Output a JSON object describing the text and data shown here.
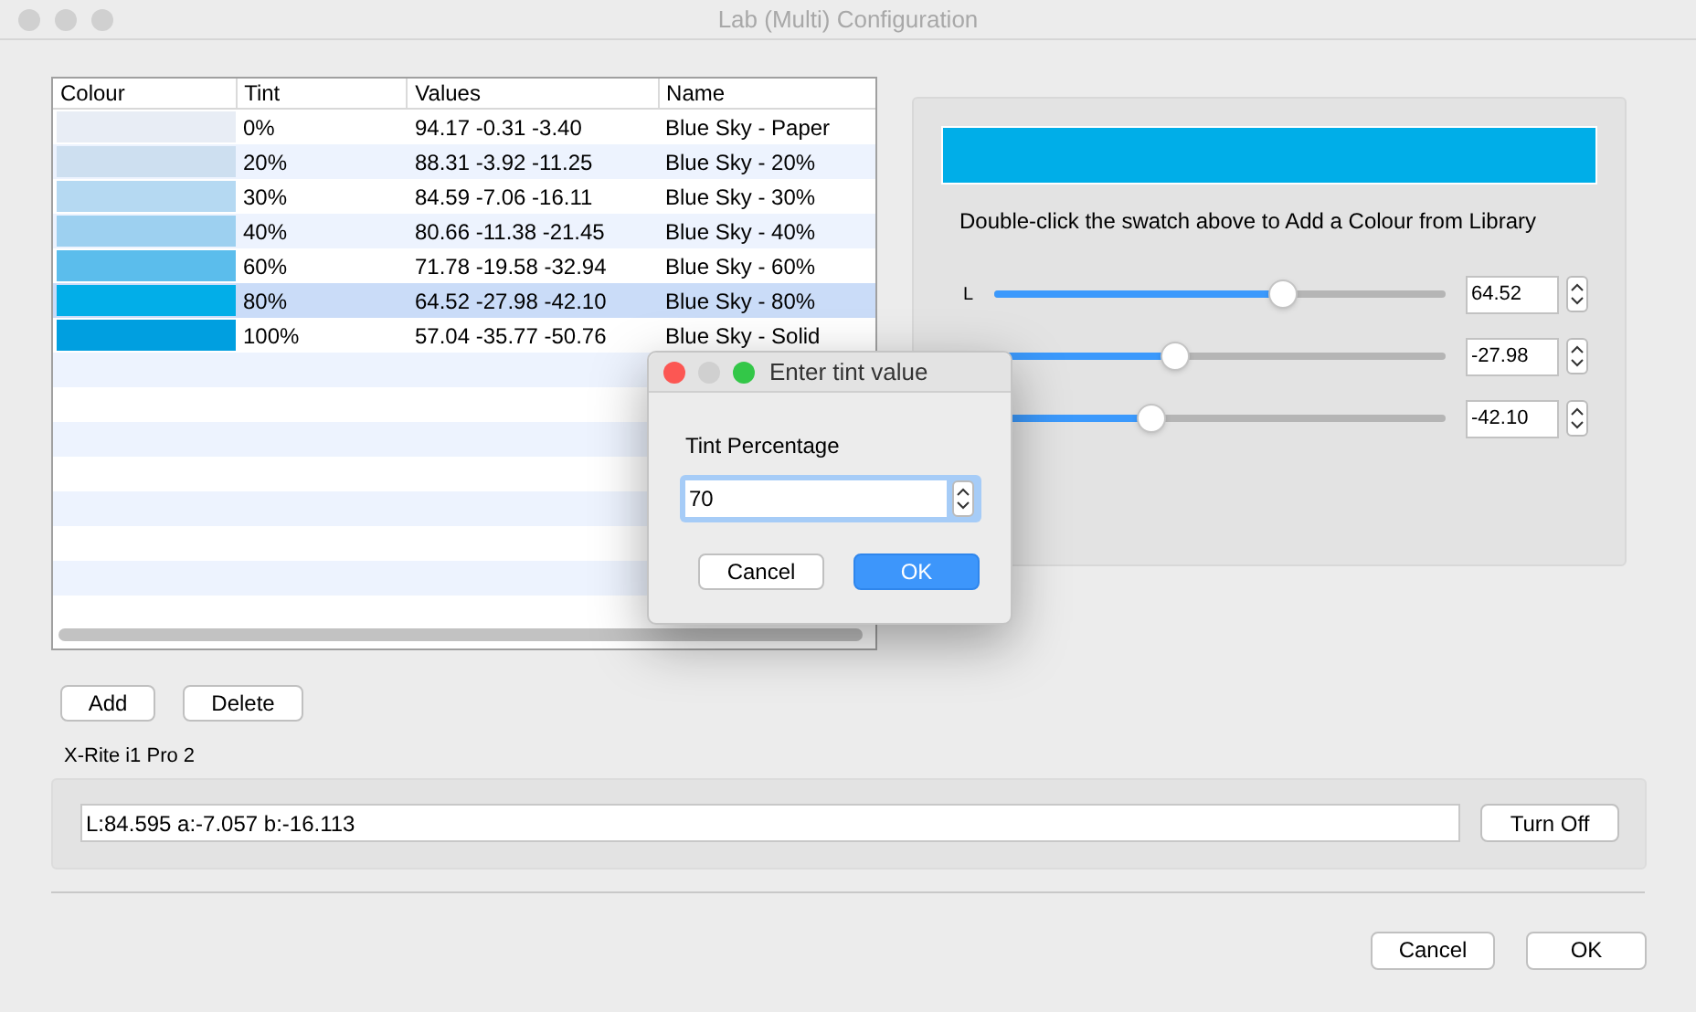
{
  "window": {
    "title": "Lab (Multi) Configuration"
  },
  "table": {
    "columns": [
      "Colour",
      "Tint",
      "Values",
      "Name"
    ],
    "rows": [
      {
        "color": "#e8edf5",
        "tint": "0%",
        "values": "94.17 -0.31 -3.40",
        "name": "Blue Sky - Paper",
        "selected": false
      },
      {
        "color": "#cddff0",
        "tint": "20%",
        "values": "88.31 -3.92 -11.25",
        "name": "Blue Sky - 20%",
        "selected": false
      },
      {
        "color": "#b5d9f2",
        "tint": "30%",
        "values": "84.59 -7.06 -16.11",
        "name": "Blue Sky - 30%",
        "selected": false
      },
      {
        "color": "#9dd0f0",
        "tint": "40%",
        "values": "80.66 -11.38 -21.45",
        "name": "Blue Sky - 40%",
        "selected": false
      },
      {
        "color": "#5bbdec",
        "tint": "60%",
        "values": "71.78 -19.58 -32.94",
        "name": "Blue Sky - 60%",
        "selected": false
      },
      {
        "color": "#02aee8",
        "tint": "80%",
        "values": "64.52 -27.98 -42.10",
        "name": "Blue Sky - 80%",
        "selected": true
      },
      {
        "color": "#009fe0",
        "tint": "100%",
        "values": "57.04 -35.77 -50.76",
        "name": "Blue Sky - Solid",
        "selected": false
      }
    ]
  },
  "list_buttons": [
    "Add",
    "Delete"
  ],
  "editor": {
    "hint": "Double-click the swatch above to Add a Colour from Library",
    "sliders": [
      {
        "label": "L",
        "level": 0.64,
        "value": "64.52"
      },
      {
        "level": 0.4,
        "value": "-27.98"
      },
      {
        "level": 0.35,
        "value": "-42.10"
      }
    ]
  },
  "device": {
    "title": "X-Rite i1 Pro 2",
    "reading": "L:84.595 a:-7.057 b:-16.113",
    "button": "Turn Off"
  },
  "buttons": [
    "Cancel",
    "OK"
  ],
  "dialog": {
    "title": "Enter tint value",
    "label": "Tint Percentage",
    "value": "70",
    "buttons": [
      "Cancel",
      "OK"
    ]
  }
}
